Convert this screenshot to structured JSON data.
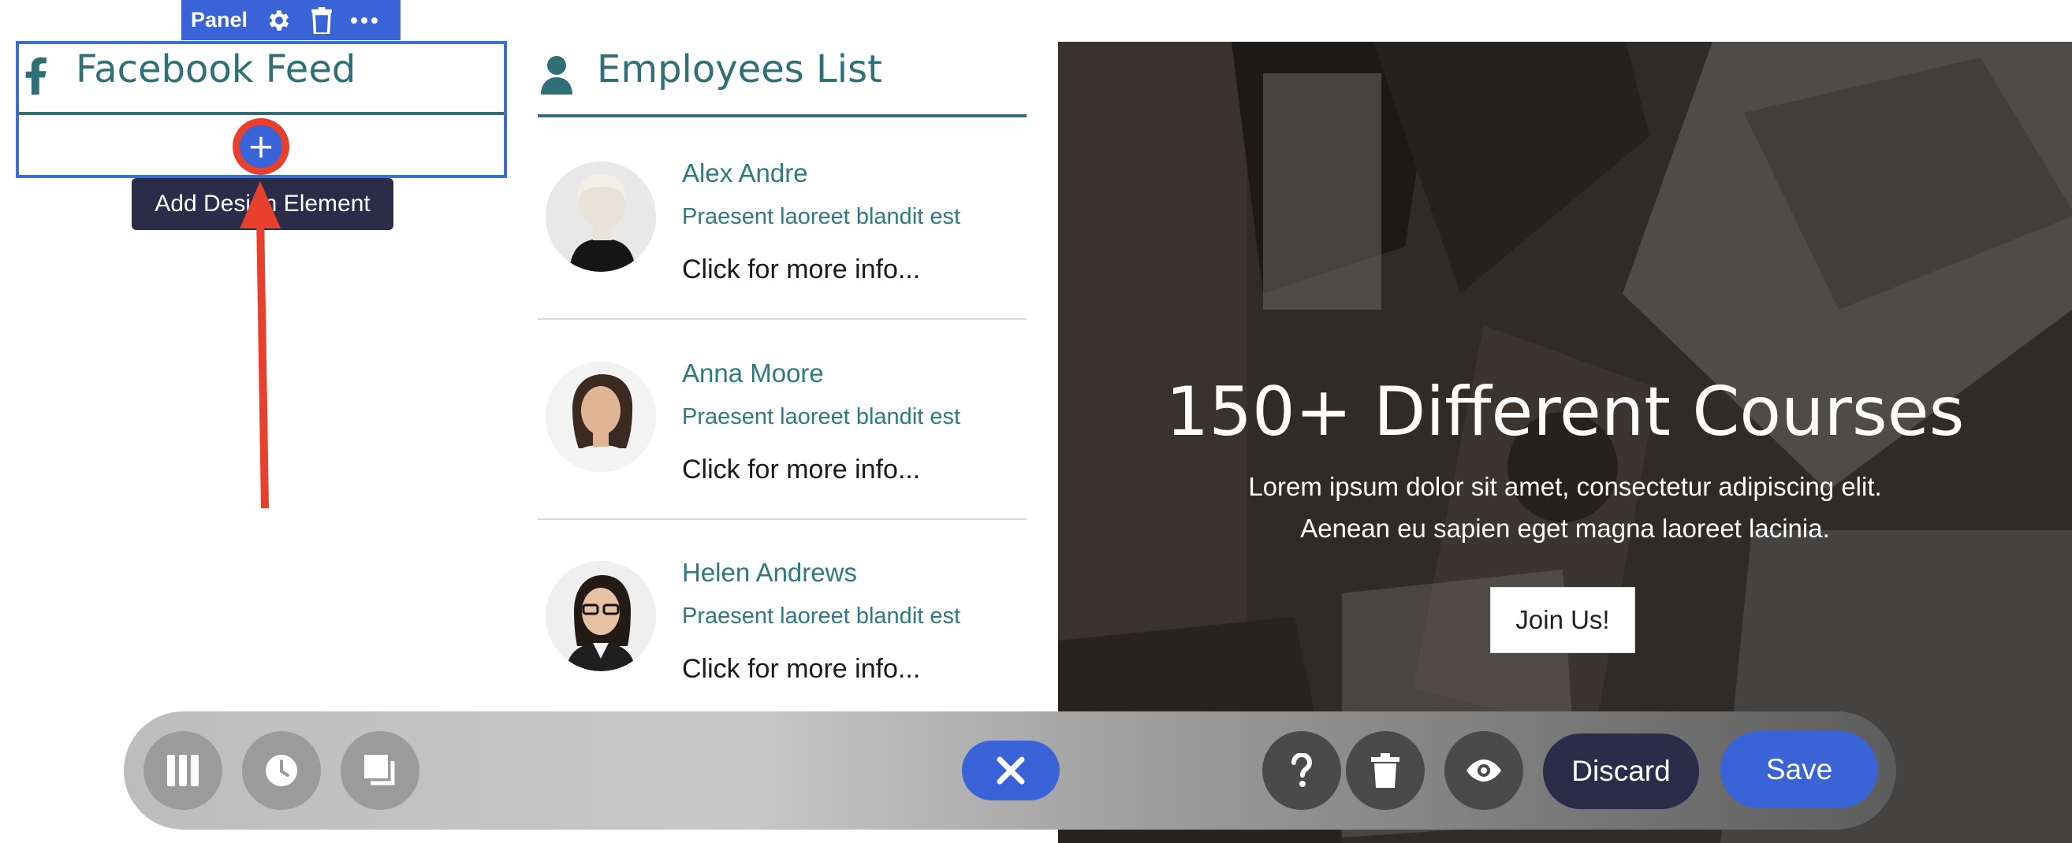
{
  "panel": {
    "toolbar": {
      "label": "Panel",
      "icons": [
        "gear-icon",
        "trash-icon",
        "more-icon"
      ]
    },
    "title": "Facebook Feed",
    "icon": "facebook-icon",
    "add_tooltip": "Add Design Element"
  },
  "employees": {
    "title": "Employees List",
    "icon": "person-icon",
    "items": [
      {
        "name": "Alex Andre",
        "subtitle": "Praesent laoreet blandit est",
        "more": "Click for more info..."
      },
      {
        "name": "Anna Moore",
        "subtitle": "Praesent laoreet blandit est",
        "more": "Click for more info..."
      },
      {
        "name": "Helen Andrews",
        "subtitle": "Praesent laoreet blandit est",
        "more": "Click for more info..."
      }
    ]
  },
  "hero": {
    "title": "150+ Different Courses",
    "subtitle_line1": "Lorem ipsum dolor sit amet, consectetur adipiscing elit.",
    "subtitle_line2": "Aenean eu sapien eget magna laoreet lacinia.",
    "button": "Join Us!"
  },
  "bottom_toolbar": {
    "left_icons": [
      "columns-icon",
      "history-icon",
      "layers-icon"
    ],
    "center_icon": "close-icon",
    "right_icons": [
      "help-icon",
      "trash-icon",
      "preview-eye-icon"
    ],
    "discard_label": "Discard",
    "save_label": "Save"
  },
  "colors": {
    "accent": "#3b63d8",
    "teal": "#2f6f78",
    "annotation_red": "#e8402c",
    "tooltip_bg": "#2a2c4a",
    "discard_bg": "#2a2c4a"
  }
}
